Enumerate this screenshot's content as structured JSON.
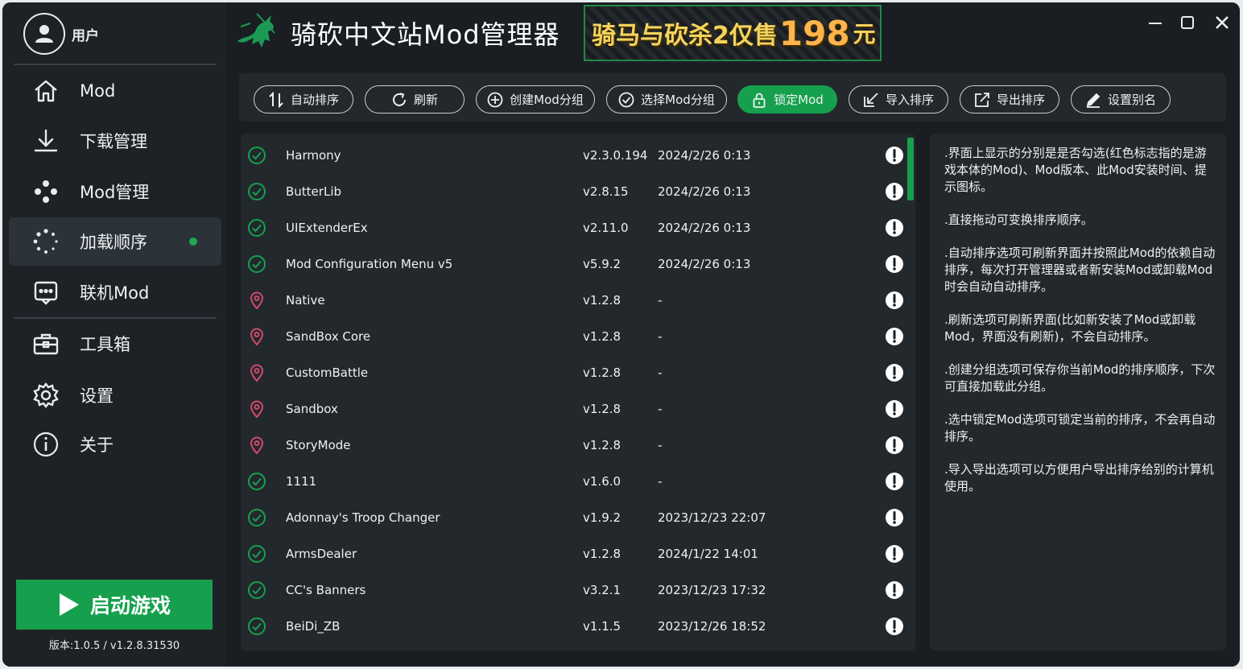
{
  "user": {
    "name": "用户"
  },
  "app": {
    "title": "骑砍中文站Mod管理器"
  },
  "banner": {
    "text": "骑马与砍杀2仅售",
    "price": "198",
    "unit": "元"
  },
  "nav": [
    {
      "label": "Mod",
      "icon": "home-icon"
    },
    {
      "label": "下载管理",
      "icon": "download-icon"
    },
    {
      "label": "Mod管理",
      "icon": "dots-icon"
    },
    {
      "label": "加载顺序",
      "icon": "loading-icon",
      "active": true
    },
    {
      "label": "联机Mod",
      "icon": "chat-icon"
    },
    {
      "label": "工具箱",
      "icon": "toolbox-icon"
    },
    {
      "label": "设置",
      "icon": "gear-icon"
    },
    {
      "label": "关于",
      "icon": "info-icon"
    }
  ],
  "launch": {
    "label": "启动游戏"
  },
  "version": "版本:1.0.5 / v1.2.8.31530",
  "toolbar": {
    "auto_sort": "自动排序",
    "refresh": "刷新",
    "create_group": "创建Mod分组",
    "select_group": "选择Mod分组",
    "lock_mod": "锁定Mod",
    "import_order": "导入排序",
    "export_order": "导出排序",
    "set_alias": "设置别名"
  },
  "mods": [
    {
      "name": "Harmony",
      "version": "v2.3.0.194",
      "date": "2024/2/26 0:13",
      "status": "check"
    },
    {
      "name": "ButterLib",
      "version": "v2.8.15",
      "date": "2024/2/26 0:13",
      "status": "check"
    },
    {
      "name": "UIExtenderEx",
      "version": "v2.11.0",
      "date": "2024/2/26 0:13",
      "status": "check"
    },
    {
      "name": "Mod Configuration Menu v5",
      "version": "v5.9.2",
      "date": "2024/2/26 0:13",
      "status": "check"
    },
    {
      "name": "Native",
      "version": "v1.2.8",
      "date": "-",
      "status": "pin"
    },
    {
      "name": "SandBox Core",
      "version": "v1.2.8",
      "date": "-",
      "status": "pin"
    },
    {
      "name": "CustomBattle",
      "version": "v1.2.8",
      "date": "-",
      "status": "pin"
    },
    {
      "name": "Sandbox",
      "version": "v1.2.8",
      "date": "-",
      "status": "pin"
    },
    {
      "name": "StoryMode",
      "version": "v1.2.8",
      "date": "-",
      "status": "pin"
    },
    {
      "name": "1111",
      "version": "v1.6.0",
      "date": "-",
      "status": "check"
    },
    {
      "name": "Adonnay's Troop Changer",
      "version": "v1.9.2",
      "date": "2023/12/23 22:07",
      "status": "check"
    },
    {
      "name": "ArmsDealer",
      "version": "v1.2.8",
      "date": "2024/1/22 14:01",
      "status": "check"
    },
    {
      "name": "CC's Banners",
      "version": "v3.2.1",
      "date": "2023/12/23 17:32",
      "status": "check"
    },
    {
      "name": "BeiDi_ZB",
      "version": "v1.1.5",
      "date": "2023/12/26 18:52",
      "status": "check"
    }
  ],
  "help": [
    ".界面上显示的分别是是否勾选(红色标志指的是游戏本体的Mod)、Mod版本、此Mod安装时间、提示图标。",
    ".直接拖动可变换排序顺序。",
    ".自动排序选项可刷新界面并按照此Mod的依赖自动排序，每次打开管理器或者新安装Mod或卸载Mod时会自动自动排序。",
    ".刷新选项可刷新界面(比如新安装了Mod或卸载Mod，界面没有刷新)，不会自动排序。",
    ".创建分组选项可保存你当前Mod的排序顺序，下次可直接加载此分组。",
    ".选中锁定Mod选项可锁定当前的排序，不会再自动排序。",
    ".导入导出选项可以方便用户导出排序给别的计算机使用。"
  ],
  "colors": {
    "accent": "#16a04d",
    "pin": "#d04a6a",
    "bg": "#1a1e22",
    "panel": "#23282d"
  }
}
